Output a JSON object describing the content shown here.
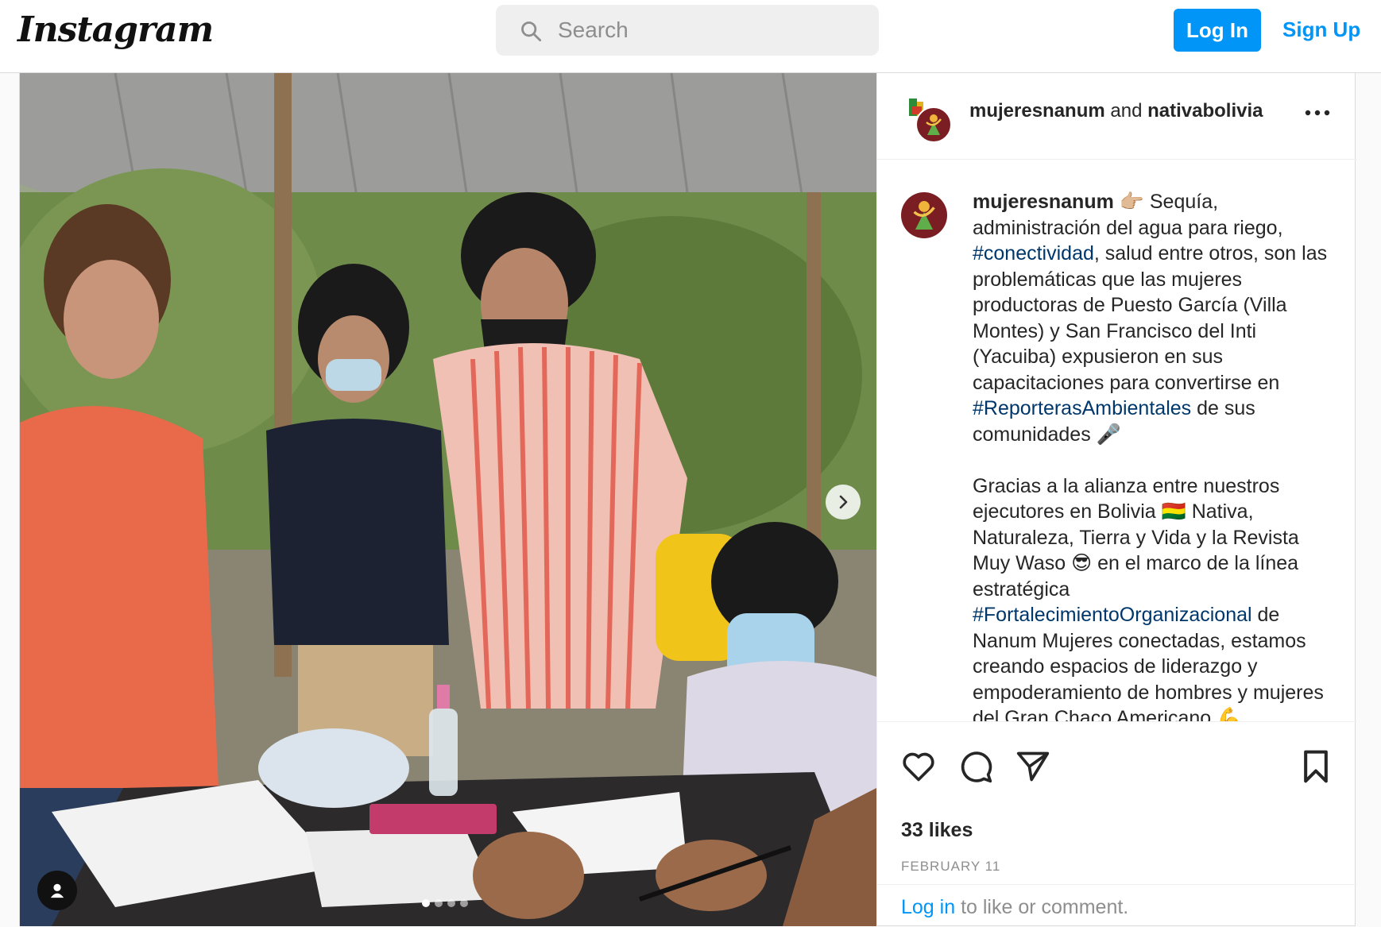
{
  "nav": {
    "logo": "Instagram",
    "search_placeholder": "Search",
    "login_label": "Log In",
    "signup_label": "Sign Up"
  },
  "post": {
    "header": {
      "author": "mujeresnanum",
      "joiner": "and",
      "collaborator": "nativabolivia"
    },
    "caption": {
      "username": "mujeresnanum",
      "p1a": " 👉🏼 Sequía, administración del agua para riego, ",
      "tag1": "#conectividad",
      "p1b": ", salud entre otros, son las problemáticas que las mujeres productoras de Puesto García (Villa Montes) y San Francisco del Inti (Yacuiba) expusieron en sus capacitaciones para convertirse en ",
      "tag2": "#ReporterasAmbientales",
      "p1c": " de sus comunidades 🎤",
      "p2a": "Gracias a la alianza entre nuestros ejecutores en Bolivia 🇧🇴 Nativa, Naturaleza, Tierra y Vida y la Revista Muy Waso 😎 en el marco de la línea estratégica ",
      "tag3": "#FortalecimientoOrganizacional",
      "p2b": " de Nanum Mujeres conectadas, estamos creando espacios de liderazgo y empoderamiento de hombres y mujeres del Gran Chaco Americano 💪"
    },
    "likes": "33 likes",
    "date": "FEBRUARY 11",
    "comment_login": "Log in",
    "comment_rest": " to like or comment.",
    "carousel": {
      "total_slides": 4,
      "active_slide": 1
    }
  },
  "icons": {
    "search": "search-icon",
    "more": "more-options-icon",
    "like": "heart-icon",
    "comment": "comment-icon",
    "share": "share-icon",
    "save": "bookmark-icon",
    "next": "chevron-right-icon",
    "tag": "user-tag-icon"
  },
  "colors": {
    "accent": "#0095f6",
    "hashtag": "#00376b",
    "muted": "#8e8e8e"
  }
}
